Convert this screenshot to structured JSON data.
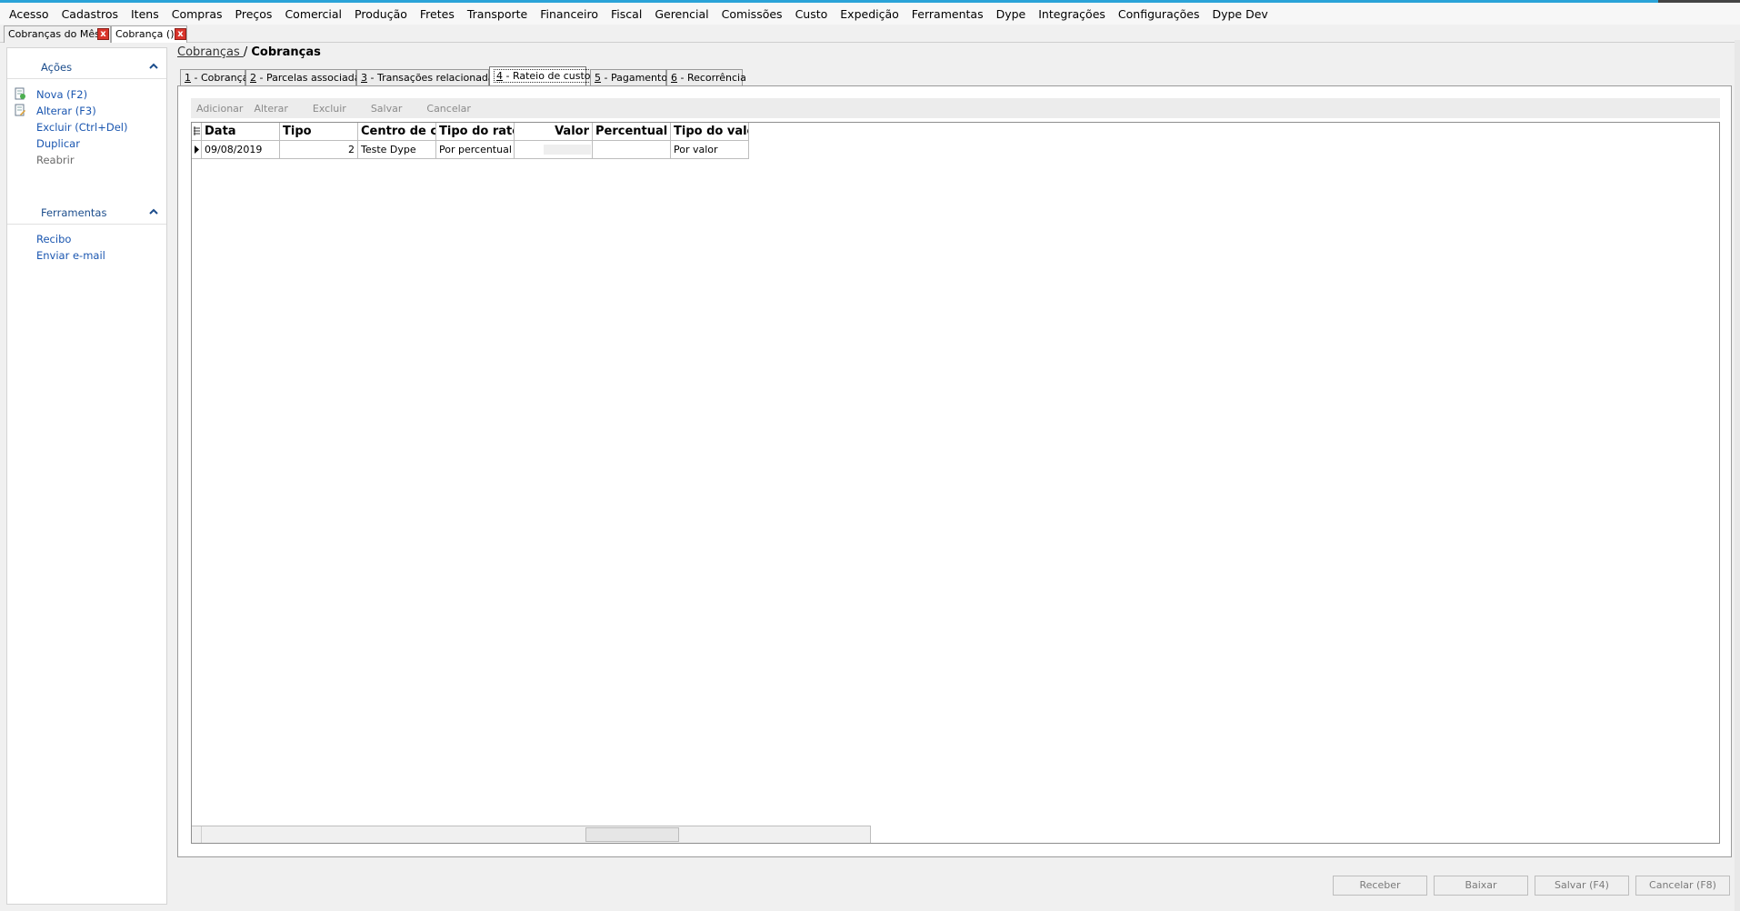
{
  "menu": [
    "Acesso",
    "Cadastros",
    "Itens",
    "Compras",
    "Preços",
    "Comercial",
    "Produção",
    "Fretes",
    "Transporte",
    "Financeiro",
    "Fiscal",
    "Gerencial",
    "Comissões",
    "Custo",
    "Expedição",
    "Ferramentas",
    "Dype",
    "Integrações",
    "Configurações",
    "Dype Dev"
  ],
  "doc_tabs": [
    {
      "label": "Cobranças do Mês",
      "close": "x"
    },
    {
      "label": "Cobrança ()",
      "close": "x"
    }
  ],
  "sidebar": {
    "acoes_title": "Ações",
    "acoes_items": [
      "Nova (F2)",
      "Alterar (F3)",
      "Excluir (Ctrl+Del)",
      "Duplicar",
      "Reabrir"
    ],
    "ferramentas_title": "Ferramentas",
    "ferramentas_items": [
      "Recibo",
      "Enviar e-mail"
    ]
  },
  "breadcrumb": {
    "link": "Cobranças ",
    "separator": "/",
    "current": "Cobranças"
  },
  "tabs": [
    {
      "key": "1",
      "label": " - Cobrança"
    },
    {
      "key": "2",
      "label": " - Parcelas associadas"
    },
    {
      "key": "3",
      "label": " - Transações relacionadas"
    },
    {
      "key": "4",
      "label": " - Rateio de custos"
    },
    {
      "key": "5",
      "label": " - Pagamentos"
    },
    {
      "key": "6",
      "label": " - Recorrência"
    }
  ],
  "toolbar": {
    "add": "Adicionar",
    "edit": "Alterar",
    "delete": "Excluir",
    "save": "Salvar",
    "cancel": "Cancelar"
  },
  "grid": {
    "columns": [
      "Data",
      "Tipo",
      "Centro de custo",
      "Tipo do rateio",
      "Valor",
      "Percentual",
      "Tipo do valor"
    ],
    "rows": [
      {
        "data": "09/08/2019",
        "tipo": "2",
        "centro": "Teste Dype",
        "tipo_rateio": "Por percentual",
        "valor": "",
        "percentual": "",
        "tipo_valor": "Por valor"
      }
    ]
  },
  "bottom_buttons": {
    "receber": "Receber",
    "baixar": "Baixar",
    "salvar": "Salvar (F4)",
    "cancelar": "Cancelar (F8)"
  },
  "colors": {
    "accent": "#2aa3d8",
    "link": "#1a56b0",
    "close_red": "#d9342b"
  }
}
